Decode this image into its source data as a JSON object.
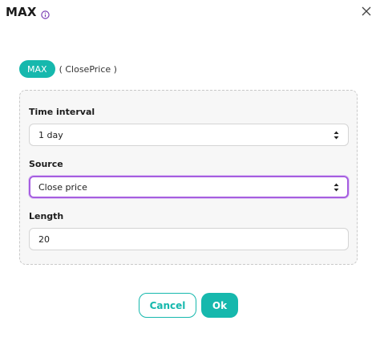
{
  "dialog": {
    "title": "MAX",
    "info_icon": "info-icon",
    "close_icon": "close-icon"
  },
  "indicator": {
    "name": "MAX",
    "args": "( ClosePrice )"
  },
  "form": {
    "time_interval": {
      "label": "Time interval",
      "value": "1 day"
    },
    "source": {
      "label": "Source",
      "value": "Close price"
    },
    "length": {
      "label": "Length",
      "value": "20"
    }
  },
  "actions": {
    "cancel_label": "Cancel",
    "ok_label": "Ok"
  },
  "colors": {
    "accent": "#16b8ad",
    "focus": "#a65ee0",
    "info": "#7b3fb5"
  }
}
